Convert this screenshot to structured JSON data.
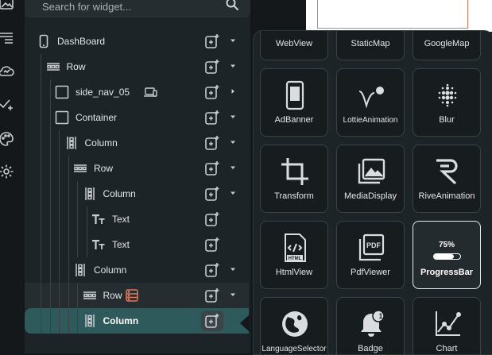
{
  "search": {
    "placeholder": "Search for widget..."
  },
  "rail": {
    "icons": [
      "image-icon",
      "list-icon",
      "cloud-icon",
      "check-plus-icon",
      "palette-icon",
      "settings-icon"
    ]
  },
  "tree": {
    "nodes": [
      {
        "label": "DashBoard",
        "icon": "phone-icon",
        "depth": 0,
        "caret": "down"
      },
      {
        "label": "Row",
        "icon": "row-icon",
        "depth": 1,
        "caret": "down"
      },
      {
        "label": "side_nav_05",
        "icon": "square-icon",
        "depth": 2,
        "caret": "right",
        "badge": "laptop-icon"
      },
      {
        "label": "Container",
        "icon": "square-icon",
        "depth": 2,
        "caret": "down"
      },
      {
        "label": "Column",
        "icon": "column-icon",
        "depth": 3,
        "caret": "down"
      },
      {
        "label": "Row",
        "icon": "row-icon",
        "depth": 4,
        "caret": "down"
      },
      {
        "label": "Column",
        "icon": "column-icon",
        "depth": 5,
        "caret": "down"
      },
      {
        "label": "Text",
        "icon": "text-icon",
        "depth": 6,
        "caret": ""
      },
      {
        "label": "Text",
        "icon": "text-icon",
        "depth": 6,
        "caret": ""
      },
      {
        "label": "Column",
        "icon": "column-icon",
        "depth": 4,
        "caret": "down"
      },
      {
        "label": "Row",
        "icon": "row-icon",
        "depth": 5,
        "caret": "down",
        "badge": "list-orange-icon"
      },
      {
        "label": "Column",
        "icon": "column-icon",
        "depth": 5,
        "caret": "",
        "selected": true
      }
    ]
  },
  "widgets": [
    {
      "label": "WebView",
      "icon": ""
    },
    {
      "label": "StaticMap",
      "icon": ""
    },
    {
      "label": "GoogleMap",
      "icon": ""
    },
    {
      "label": "AdBanner",
      "icon": "ad-banner-icon"
    },
    {
      "label": "LottieAnimation",
      "icon": "lottie-icon"
    },
    {
      "label": "Blur",
      "icon": "blur-icon"
    },
    {
      "label": "Transform",
      "icon": "crop-icon"
    },
    {
      "label": "MediaDisplay",
      "icon": "media-icon"
    },
    {
      "label": "RiveAnimation",
      "icon": "rive-icon"
    },
    {
      "label": "HtmlView",
      "icon": "html-icon"
    },
    {
      "label": "PdfViewer",
      "icon": "pdf-icon"
    },
    {
      "label": "ProgressBar",
      "icon": "progress-icon",
      "selected": true,
      "percent_label": "75%",
      "progress": 0.75
    },
    {
      "label": "LanguageSelector",
      "icon": "globe-icon"
    },
    {
      "label": "Badge",
      "icon": "badge-bell-icon",
      "badge_count": "1"
    },
    {
      "label": "Chart",
      "icon": "chart-icon"
    }
  ],
  "colors": {
    "selected_row": "#2e5a5c",
    "panel": "#1d2428",
    "background": "#14181b",
    "accent_orange": "#e07a5f"
  }
}
